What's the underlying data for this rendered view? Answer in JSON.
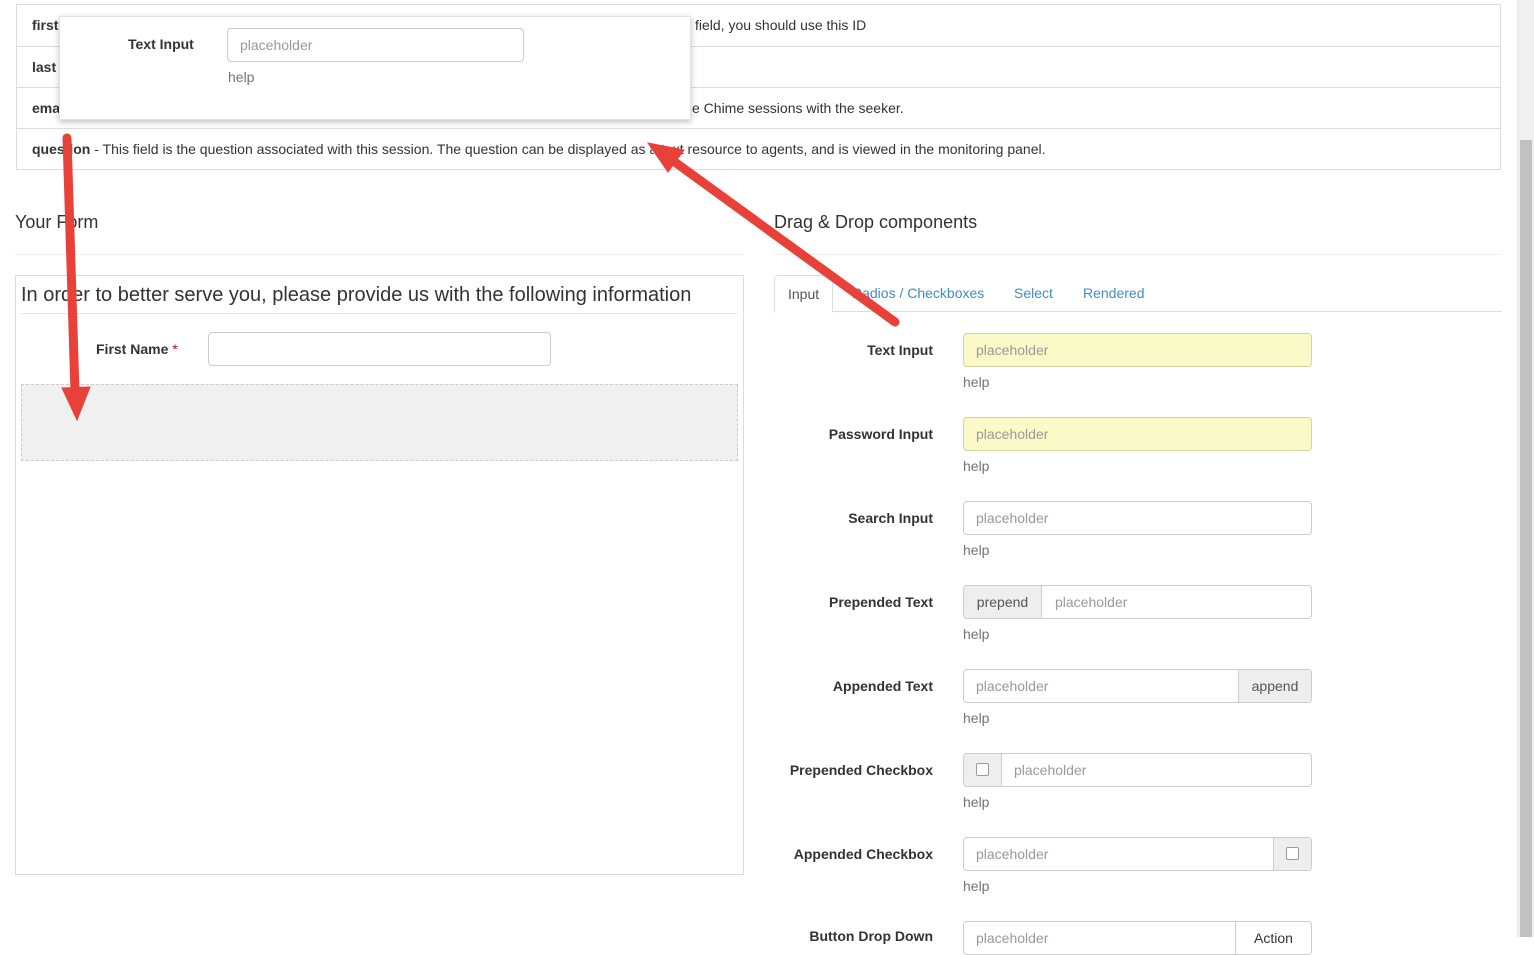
{
  "fields": [
    {
      "key": "first",
      "desc": "field, you should use this ID"
    },
    {
      "key": "last",
      "desc": ""
    },
    {
      "key": "ema",
      "desc": "e Chime sessions with the seeker."
    },
    {
      "key": "question",
      "desc": " - This field is the question associated with this session. The question can be displayed as a text resource to agents, and is viewed in the monitoring panel."
    }
  ],
  "drag_popup": {
    "label": "Text Input",
    "placeholder": "placeholder",
    "help": "help"
  },
  "your_form": {
    "heading": "Your Form",
    "legend": "In order to better serve you, please provide us with the following information",
    "first_name_label": "First Name",
    "required_mark": "*"
  },
  "components": {
    "heading": "Drag & Drop components",
    "tabs": [
      "Input",
      "Radios / Checkboxes",
      "Select",
      "Rendered"
    ],
    "items": [
      {
        "label": "Text Input",
        "placeholder": "placeholder",
        "help": "help"
      },
      {
        "label": "Password Input",
        "placeholder": "placeholder",
        "help": "help"
      },
      {
        "label": "Search Input",
        "placeholder": "placeholder",
        "help": "help"
      },
      {
        "label": "Prepended Text",
        "placeholder": "placeholder",
        "addon": "prepend",
        "help": "help"
      },
      {
        "label": "Appended Text",
        "placeholder": "placeholder",
        "addon": "append",
        "help": "help"
      },
      {
        "label": "Prepended Checkbox",
        "placeholder": "placeholder",
        "help": "help"
      },
      {
        "label": "Appended Checkbox",
        "placeholder": "placeholder",
        "help": "help"
      },
      {
        "label": "Button Drop Down",
        "placeholder": "placeholder",
        "addon": "Action"
      }
    ]
  },
  "colors": {
    "link": "#428bca",
    "highlight_input": "#fafac8",
    "arrow": "#e8413a"
  }
}
